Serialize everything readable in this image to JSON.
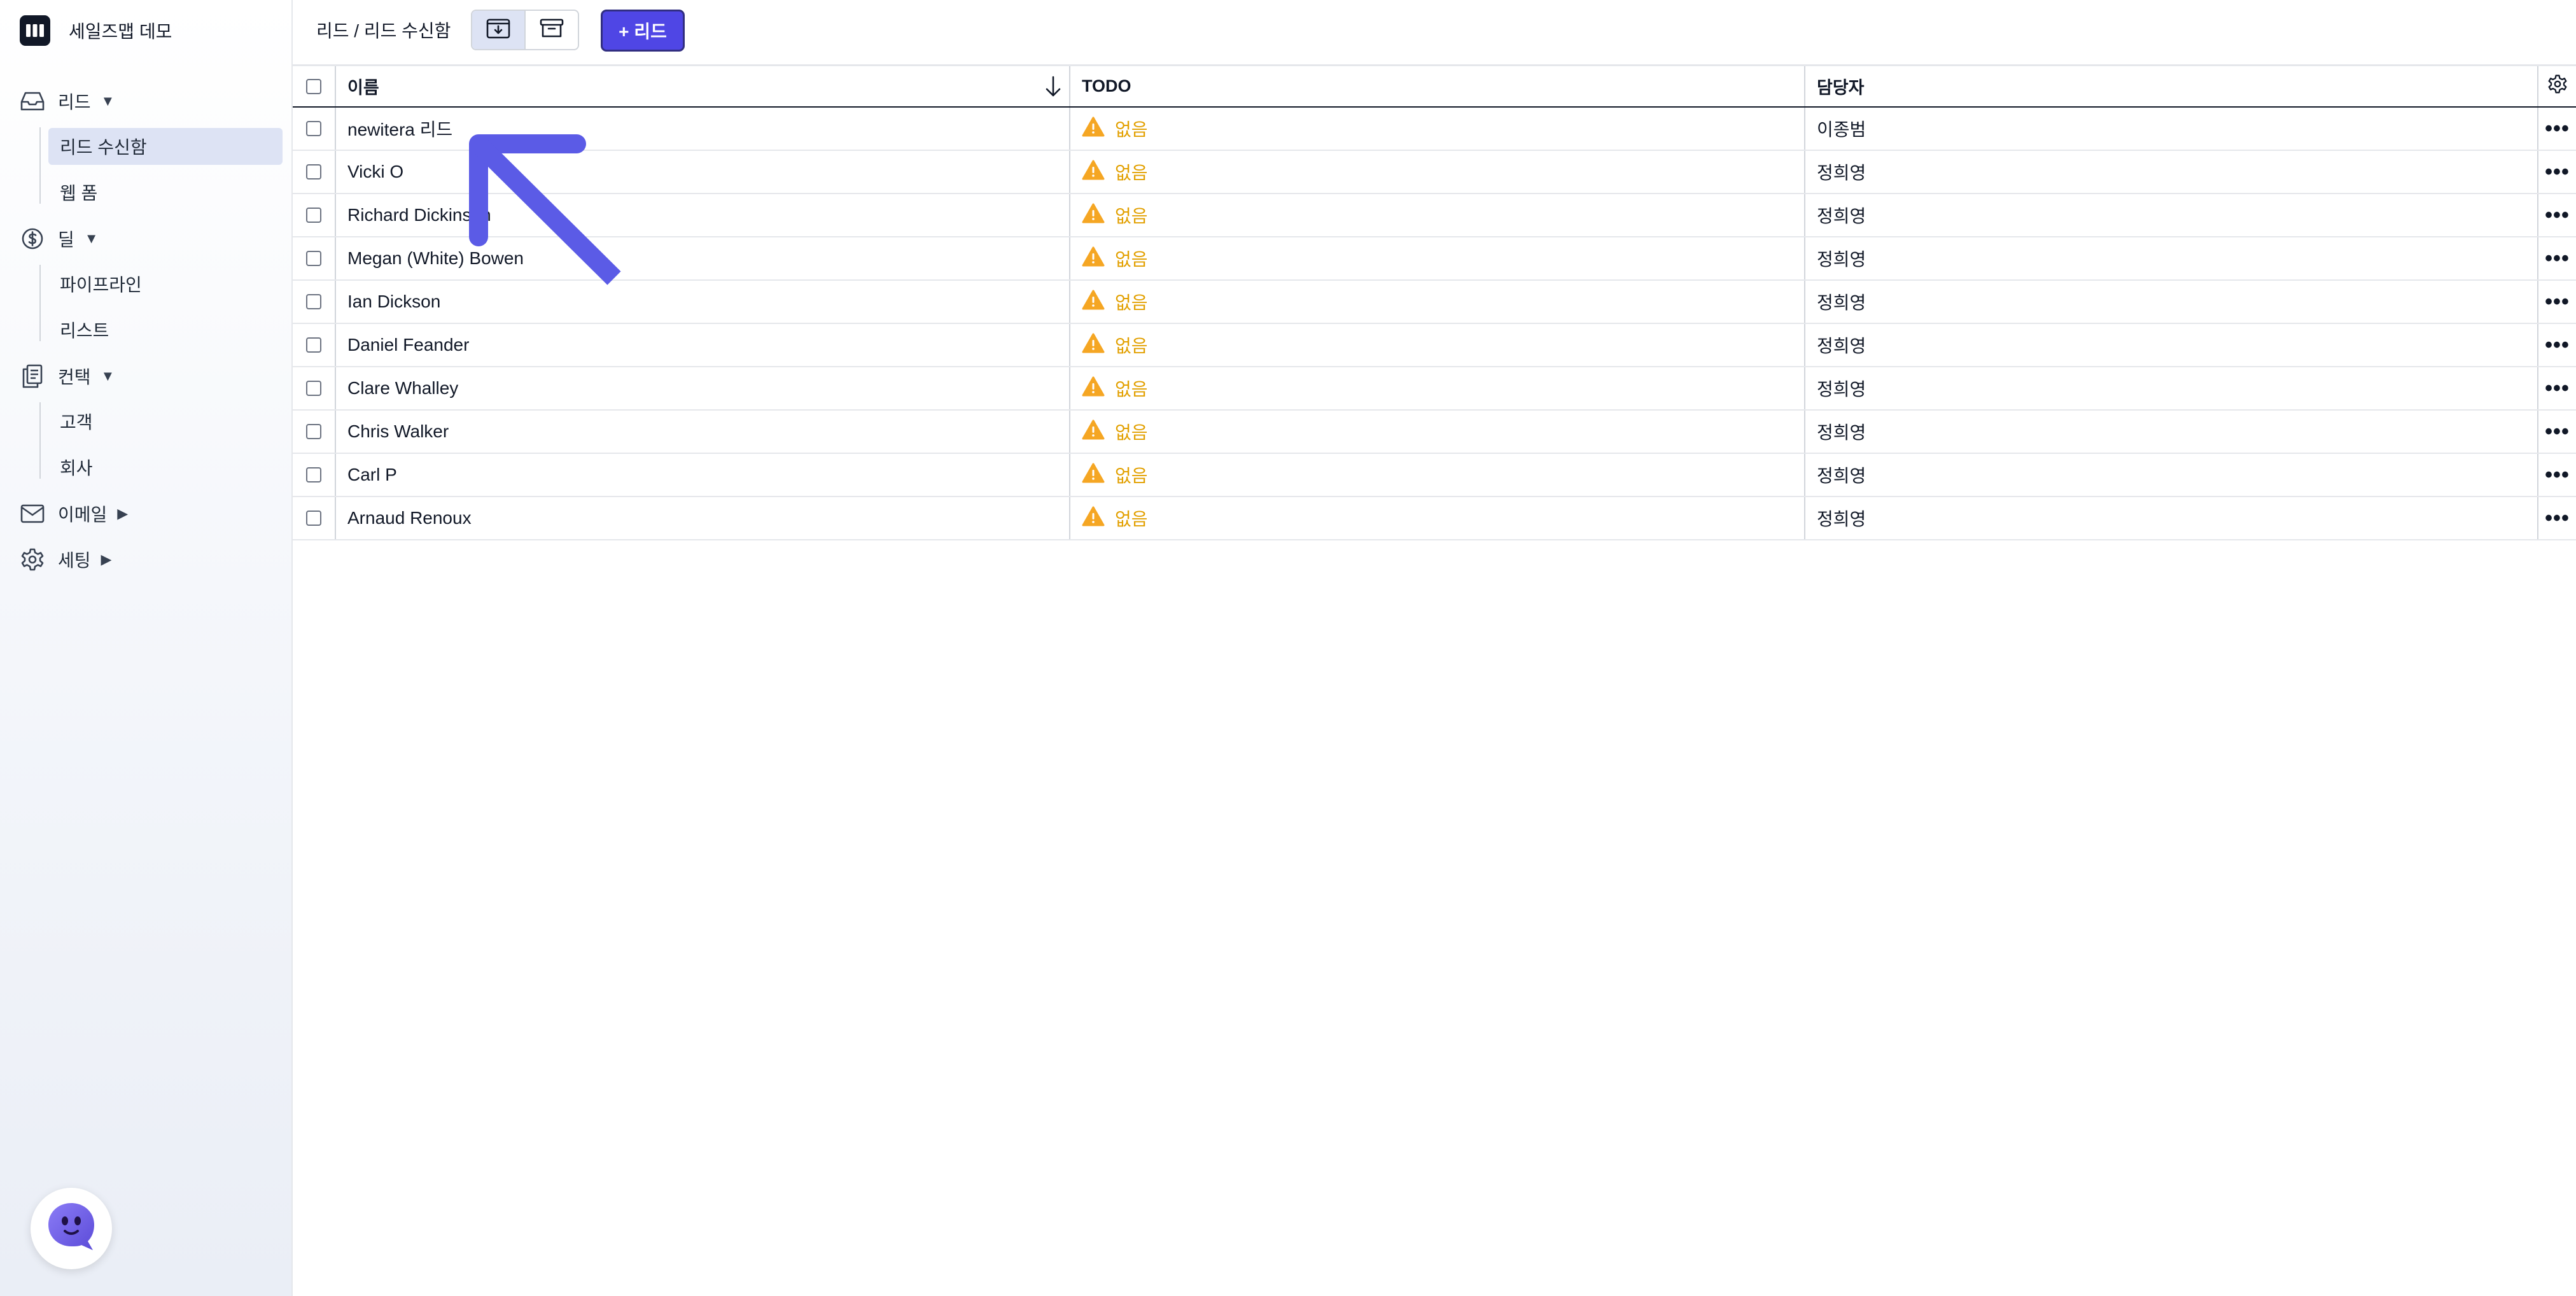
{
  "app": {
    "name": "세일즈맵 데모"
  },
  "sidebar": {
    "groups": [
      {
        "label": "리드",
        "icon": "inbox-icon",
        "expanded": true,
        "items": [
          {
            "label": "리드 수신함",
            "active": true
          },
          {
            "label": "웹 폼",
            "active": false
          }
        ]
      },
      {
        "label": "딜",
        "icon": "dollar-icon",
        "expanded": true,
        "items": [
          {
            "label": "파이프라인",
            "active": false
          },
          {
            "label": "리스트",
            "active": false
          }
        ]
      },
      {
        "label": "컨택",
        "icon": "contacts-icon",
        "expanded": true,
        "items": [
          {
            "label": "고객",
            "active": false
          },
          {
            "label": "회사",
            "active": false
          }
        ]
      },
      {
        "label": "이메일",
        "icon": "mail-icon",
        "expanded": false,
        "items": []
      },
      {
        "label": "세팅",
        "icon": "gear-icon",
        "expanded": false,
        "items": []
      }
    ],
    "chatbot_icon": "chatbot-icon"
  },
  "header": {
    "breadcrumb": "리드 / 리드 수신함",
    "add_button": "+ 리드",
    "accent": "#4f46e5"
  },
  "table": {
    "columns": {
      "name": "이름",
      "todo": "TODO",
      "owner": "담당자"
    },
    "rows": [
      {
        "name": "newitera 리드",
        "todo": "없음",
        "owner": "이종범"
      },
      {
        "name": "Vicki O",
        "todo": "없음",
        "owner": "정희영"
      },
      {
        "name": "Richard Dickinson",
        "todo": "없음",
        "owner": "정희영"
      },
      {
        "name": "Megan (White) Bowen",
        "todo": "없음",
        "owner": "정희영"
      },
      {
        "name": "Ian Dickson",
        "todo": "없음",
        "owner": "정희영"
      },
      {
        "name": "Daniel Feander",
        "todo": "없음",
        "owner": "정희영"
      },
      {
        "name": "Clare Whalley",
        "todo": "없음",
        "owner": "정희영"
      },
      {
        "name": "Chris Walker",
        "todo": "없음",
        "owner": "정희영"
      },
      {
        "name": "Carl P",
        "todo": "없음",
        "owner": "정희영"
      },
      {
        "name": "Arnaud Renoux",
        "todo": "없음",
        "owner": "정희영"
      }
    ],
    "warning_color": "#f5a623"
  }
}
